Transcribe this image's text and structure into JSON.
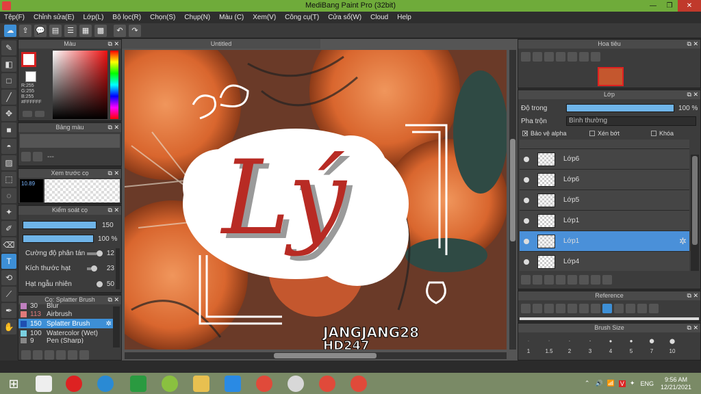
{
  "window": {
    "title": "MediBang Paint Pro (32bit)",
    "minimize": "—",
    "maximize": "❐",
    "close": "✕"
  },
  "menu": [
    "Tệp(F)",
    "Chỉnh sửa(E)",
    "Lớp(L)",
    "Bộ lọc(R)",
    "Chọn(S)",
    "Chụp(N)",
    "Màu (C)",
    "Xem(V)",
    "Công cụ(T)",
    "Cửa sổ(W)",
    "Cloud",
    "Help"
  ],
  "color_panel": {
    "title": "Màu",
    "r": "R:255",
    "g": "G:255",
    "b": "B:255",
    "hex": "#FFFFFF"
  },
  "palette_panel": {
    "title": "Bảng màu",
    "value": "---"
  },
  "brush_preview": {
    "title": "Xem trước cọ",
    "size": "10.89"
  },
  "brush_control": {
    "title": "Kiểm soát cọ",
    "size_value": "150",
    "opacity_value": "100 %",
    "size_fill": 1.0,
    "opacity_fill": 1.0,
    "scatter_label": "Cường độ phân tán",
    "scatter_value": "12",
    "grain_label": "Kích thước hạt",
    "grain_value": "23",
    "random_label": "Hạt ngẫu nhiên",
    "random_value": "50"
  },
  "brush_list": {
    "title": "Cọ: Splatter Brush",
    "items": [
      {
        "size": "30",
        "name": "Blur",
        "color": "#c080c0"
      },
      {
        "size": "113",
        "name": "Airbrush",
        "color": "#e07a7a"
      },
      {
        "size": "150",
        "name": "Splatter Brush",
        "color": "#3d6fd6"
      },
      {
        "size": "100",
        "name": "Watercolor (Wet)",
        "color": "#7ad0e0"
      },
      {
        "size": "9",
        "name": "Pen (Sharp)",
        "color": "#888888"
      }
    ]
  },
  "canvas": {
    "tab": "Untitled"
  },
  "artwork": {
    "main_text": "Lý",
    "signature_line1": "JANGJANG28",
    "signature_line2": "HD247"
  },
  "navigator": {
    "title": "Hoa tiêu"
  },
  "layer_panel": {
    "title": "Lớp",
    "opacity_label": "Độ trong",
    "opacity_value": "100 %",
    "blend_label": "Pha trộn",
    "blend_value": "Bình thường",
    "protect_alpha": "Bảo vệ alpha",
    "clipping": "Xén bớt",
    "lock": "Khóa",
    "layers": [
      "Lớp6",
      "Lớp6",
      "Lớp5",
      "Lớp1",
      "Lớp1",
      "Lớp4"
    ],
    "selected_index": 4
  },
  "reference_panel": {
    "title": "Reference"
  },
  "brush_size_panel": {
    "title": "Brush Size",
    "sizes": [
      "1",
      "1.5",
      "2",
      "3",
      "4",
      "5",
      "7",
      "10"
    ]
  },
  "taskbar": {
    "lang": "ENG",
    "time": "9:56 AM",
    "date": "12/21/2021"
  }
}
